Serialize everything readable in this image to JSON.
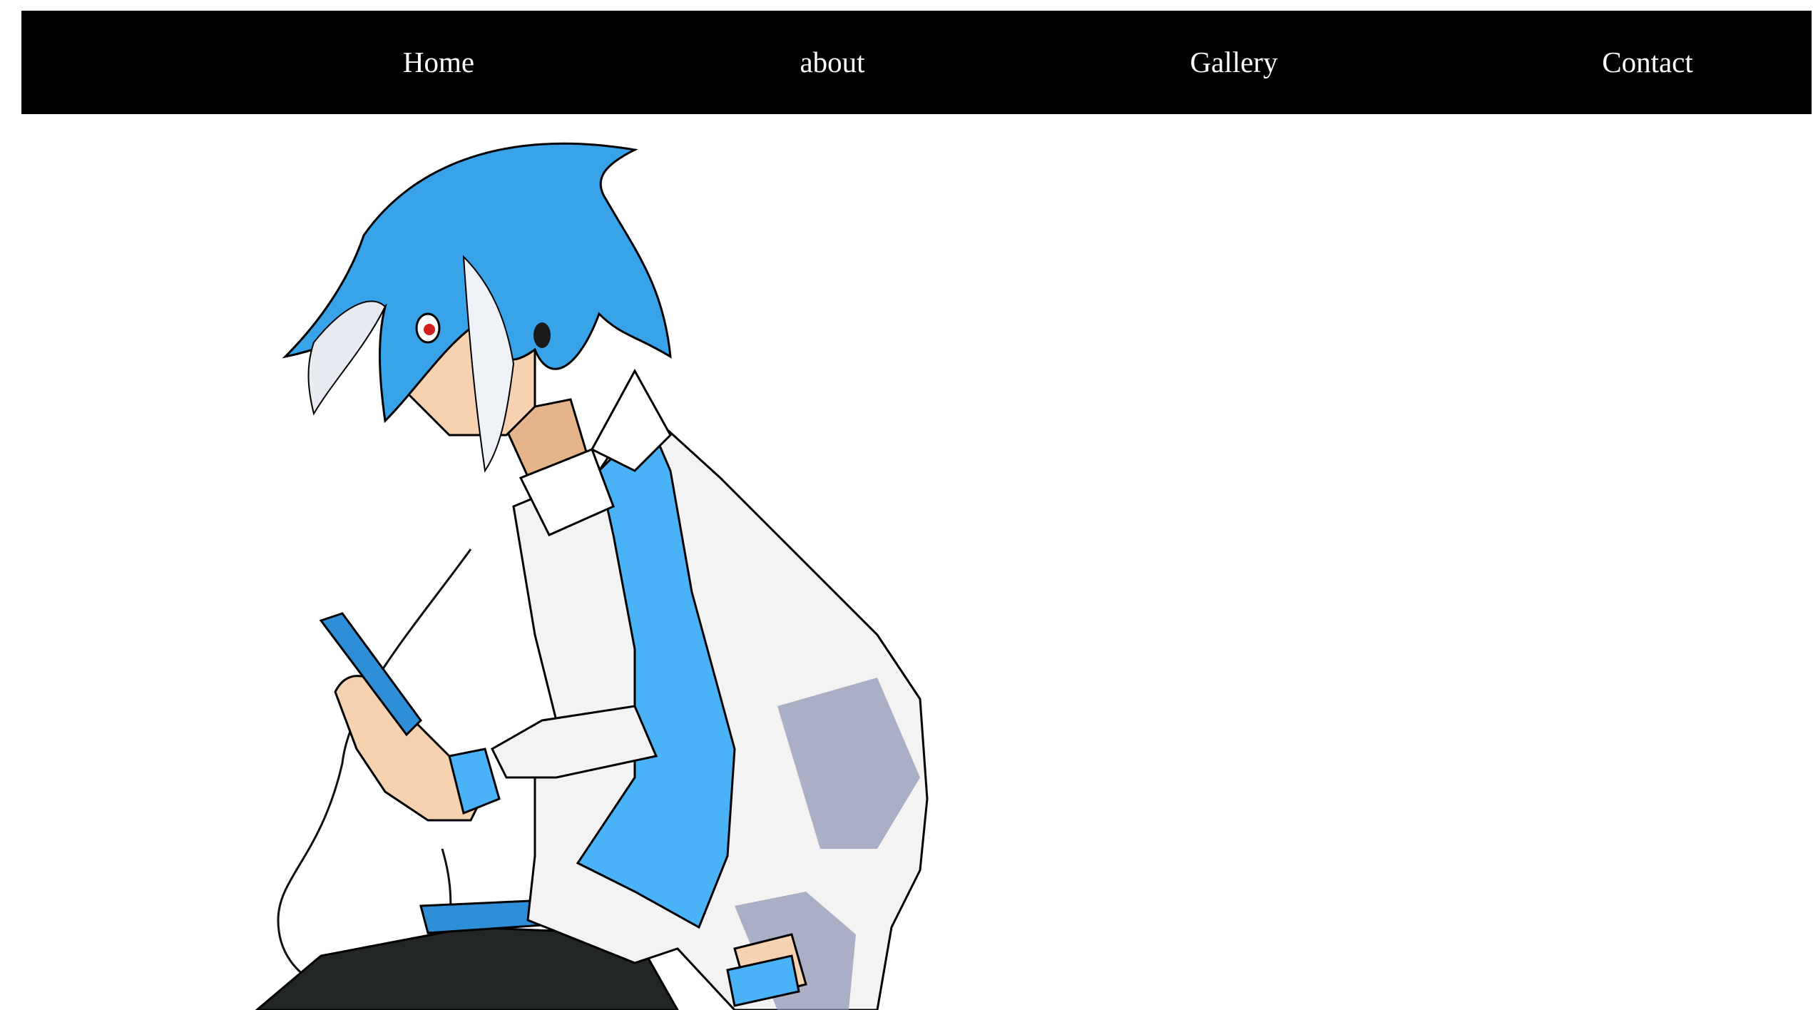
{
  "nav": {
    "items": [
      {
        "label": "Home"
      },
      {
        "label": "about"
      },
      {
        "label": "Gallery"
      },
      {
        "label": "Contact"
      }
    ]
  },
  "colors": {
    "nav_background": "#000000",
    "nav_text": "#ffffff",
    "page_background": "#ffffff",
    "hair": "#39a3ea",
    "tie": "#4ab3f7",
    "shirt": "#f3f3f3",
    "pants": "#222626"
  },
  "hero": {
    "icon": "anime-character-illustration"
  }
}
